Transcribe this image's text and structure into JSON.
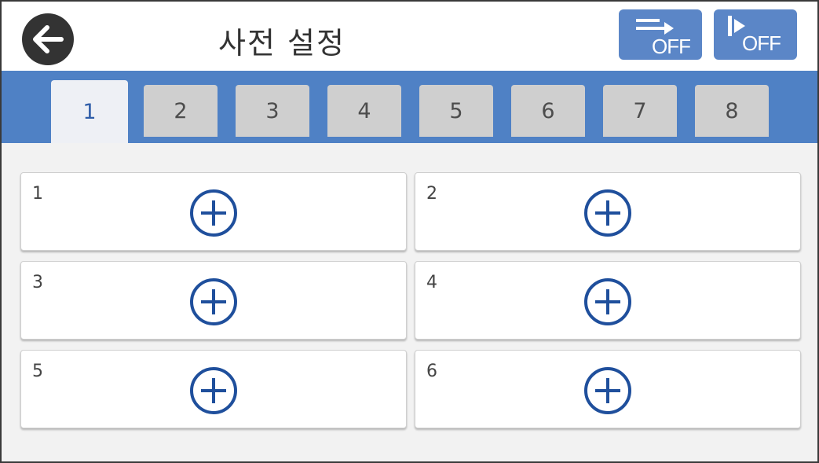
{
  "header": {
    "title": "사전 설정",
    "back_icon": "arrow-left-icon",
    "button1": {
      "icon": "feed-arrow-icon",
      "label": "OFF"
    },
    "button2": {
      "icon": "play-stop-icon",
      "label": "OFF"
    },
    "accent_color": "#5b86c7"
  },
  "tabs": [
    {
      "label": "1",
      "active": true
    },
    {
      "label": "2",
      "active": false
    },
    {
      "label": "3",
      "active": false
    },
    {
      "label": "4",
      "active": false
    },
    {
      "label": "5",
      "active": false
    },
    {
      "label": "6",
      "active": false
    },
    {
      "label": "7",
      "active": false
    },
    {
      "label": "8",
      "active": false
    }
  ],
  "slots": [
    {
      "label": "1",
      "icon": "plus-circle-icon"
    },
    {
      "label": "2",
      "icon": "plus-circle-icon"
    },
    {
      "label": "3",
      "icon": "plus-circle-icon"
    },
    {
      "label": "4",
      "icon": "plus-circle-icon"
    },
    {
      "label": "5",
      "icon": "plus-circle-icon"
    },
    {
      "label": "6",
      "icon": "plus-circle-icon"
    }
  ]
}
